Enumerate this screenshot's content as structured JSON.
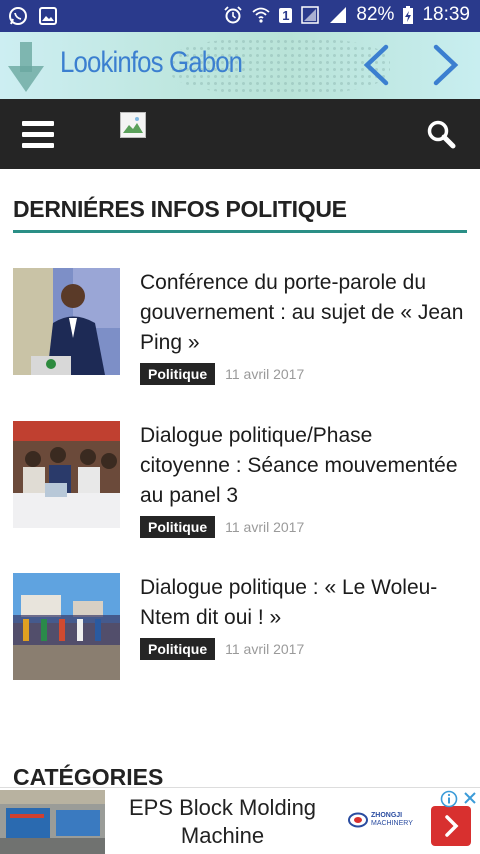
{
  "status_bar": {
    "battery": "82%",
    "time": "18:39",
    "sim_slot": "1",
    "icons": [
      "whatsapp-icon",
      "gallery-icon",
      "alarm-icon",
      "wifi-icon",
      "signal-icon",
      "battery-charging-icon"
    ]
  },
  "banner": {
    "title": "Lookinfos Gabon",
    "accent_color": "#3b7fd0"
  },
  "navbar": {
    "icons": [
      "hamburger-menu-icon",
      "broken-image-icon",
      "search-icon"
    ]
  },
  "section": {
    "title": "DERNIÉRES INFOS POLITIQUE",
    "rule_color": "#2a8f86"
  },
  "articles": [
    {
      "title": "Conférence du porte-parole du gouvernement : au sujet de « Jean Ping »",
      "category": "Politique",
      "date": "11 avril 2017"
    },
    {
      "title": "Dialogue politique/Phase citoyenne : Séance mouvementée au panel 3",
      "category": "Politique",
      "date": "11 avril 2017"
    },
    {
      "title": "Dialogue politique : « Le Woleu-Ntem dit oui ! »",
      "category": "Politique",
      "date": "11 avril 2017"
    }
  ],
  "categories_title": "CATÉGORIES",
  "ad": {
    "text": "EPS Block Molding Machine",
    "brand": "ZHONGJI",
    "brand_sub": "MACHINERY",
    "button_color": "#d8302f"
  }
}
